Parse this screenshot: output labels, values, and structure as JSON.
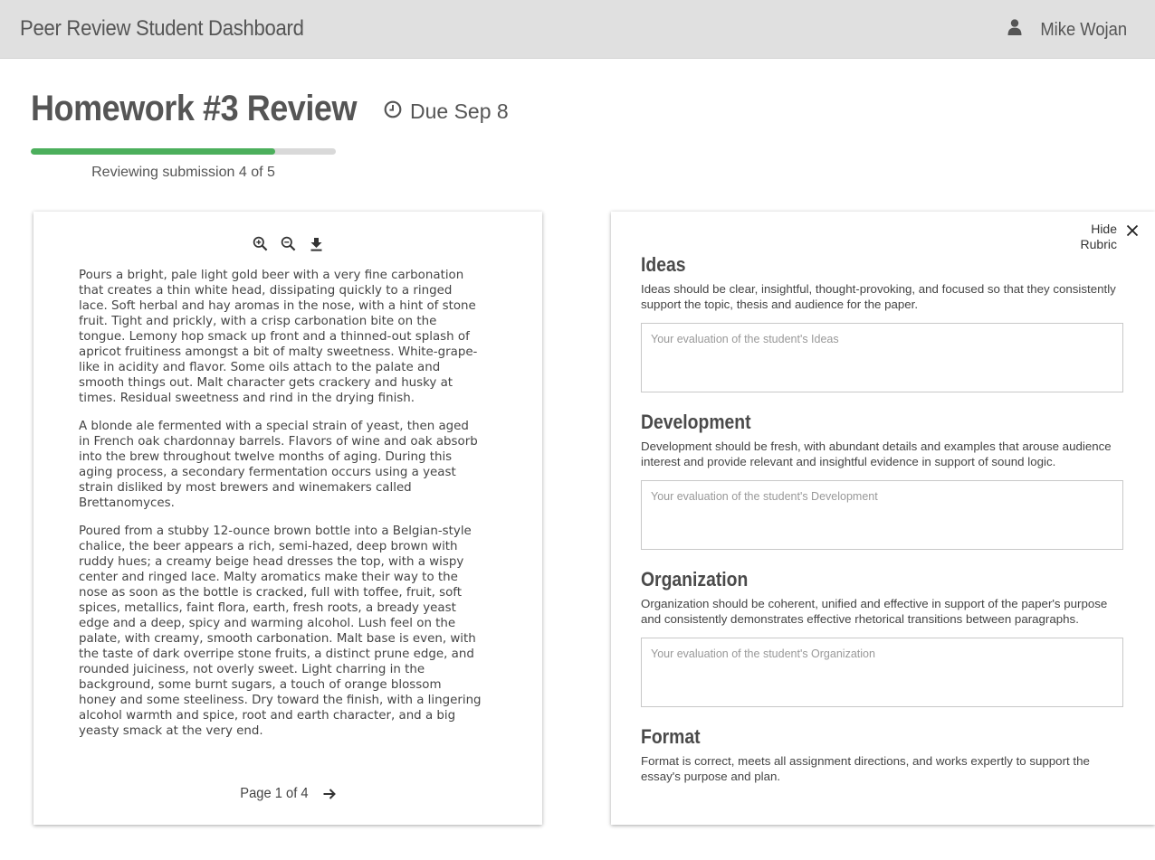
{
  "header": {
    "app_title": "Peer Review Student Dashboard",
    "user_name": "Mike Wojan",
    "user_icon": "user-icon"
  },
  "assignment": {
    "title": "Homework #3 Review",
    "due": "Due Sep 8",
    "due_icon": "clock-icon",
    "progress": {
      "current": 4,
      "total": 5,
      "fraction": 0.8
    },
    "progress_text": "Reviewing submission 4 of 5"
  },
  "document": {
    "tools": [
      "zoom-in-icon",
      "zoom-out-icon",
      "download-icon"
    ],
    "paragraphs": [
      "Pours a bright, pale light gold beer with a very fine carbonation that creates a thin white head, dissipating quickly to a ringed lace. Soft herbal and hay aromas in the nose, with a hint of stone fruit. Tight and prickly, with a crisp carbonation bite on the tongue. Lemony hop smack up front and a thinned-out splash of apricot fruitiness amongst a bit of malty sweetness. White-grape-like in acidity and flavor. Some oils attach to the palate and smooth things out. Malt character gets crackery and husky at times. Residual sweetness and rind in the drying finish.",
      "A blonde ale fermented with a special strain of yeast, then aged in French oak chardonnay barrels. Flavors of wine and oak absorb into the brew throughout twelve months of aging. During this aging process, a secondary fermentation occurs using a yeast strain disliked by most brewers and winemakers called Brettanomyces.",
      "Poured from a stubby 12-ounce brown bottle into a Belgian-style chalice, the beer appears a rich, semi-hazed, deep brown with ruddy hues; a creamy beige head dresses the top, with a wispy center and ringed lace. Malty aromatics make their way to the nose as soon as the bottle is cracked, full with toffee, fruit, soft spices, metallics, faint flora, earth, fresh roots, a bready yeast edge and a deep, spicy and warming alcohol. Lush feel on the palate, with creamy, smooth carbonation. Malt base is even, with the taste of dark overripe stone fruits, a distinct prune edge, and rounded juiciness, not overly sweet. Light charring in the background, some burnt sugars, a touch of orange blossom honey and some steeliness. Dry toward the finish, with a lingering alcohol warmth and spice, root and earth character, and a big yeasty smack at the very end."
    ],
    "pager_text": "Page 1 of 4",
    "next_icon": "arrow-right-icon"
  },
  "rubric": {
    "hide_label": "Hide Rubric",
    "close_icon": "close-icon",
    "criteria": [
      {
        "title": "Ideas",
        "description": "Ideas should be clear, insightful, thought-provoking, and focused so that they consistently support the topic, thesis and audience for the paper.",
        "placeholder": "Your evaluation of the student's Ideas"
      },
      {
        "title": "Development",
        "description": "Development should be fresh, with abundant details and examples that arouse audience interest and provide relevant and insightful evidence in support of sound logic.",
        "placeholder": "Your evaluation of the student's Development"
      },
      {
        "title": "Organization",
        "description": "Organization should be coherent, unified and effective in support of the paper's purpose and consistently demonstrates effective rhetorical transitions between paragraphs.",
        "placeholder": "Your evaluation of the student's Organization"
      },
      {
        "title": "Format",
        "description": "Format is correct, meets all assignment directions, and works expertly to support the essay's purpose and plan."
      }
    ]
  }
}
